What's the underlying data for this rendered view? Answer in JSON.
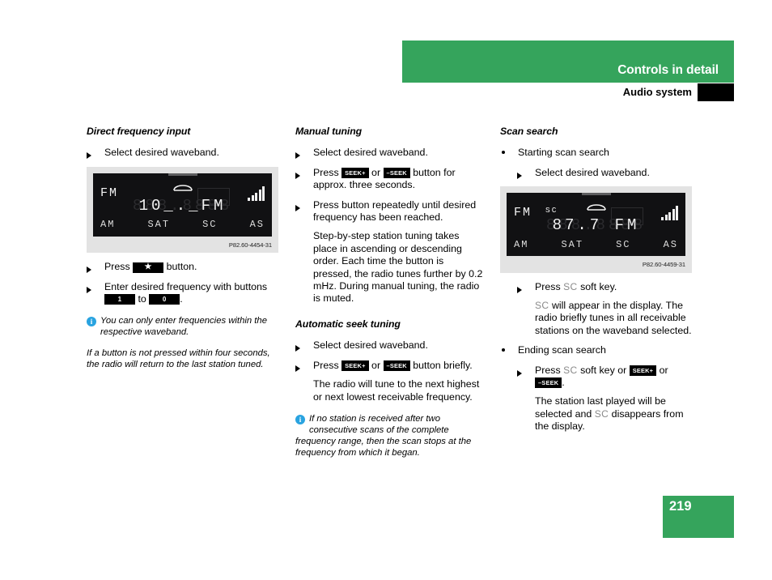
{
  "header": {
    "chapter_title": "Controls in detail",
    "section_title": "Audio system",
    "green": "#35a45c"
  },
  "footer": {
    "page_number": "219"
  },
  "columns": {
    "col1": {
      "heading": "Direct frequency input",
      "step1": "Select desired waveband.",
      "press_prefix": "Press",
      "star_key": "★",
      "press_suffix": "button.",
      "step3_text": "Enter desired frequency with buttons",
      "key_one": "1",
      "to_label": "to",
      "key_zero": "0",
      "period": ".",
      "note1": "You can only enter frequencies within the respective waveband.",
      "note2": "If a button is not pressed within four seconds, the radio will return to the last station tuned.",
      "figure": {
        "band": "FM",
        "frequency": "10_._FM",
        "ghost": "888.8888",
        "soft_keys": [
          "AM",
          "SAT",
          "SC",
          "AS"
        ],
        "caption": "P82.60-4454-31"
      }
    },
    "col2": {
      "heading1": "Manual tuning",
      "step1": "Select desired waveband.",
      "step2_pre": "Press",
      "key_seek_plus": "SEEK+",
      "or_label": "or",
      "key_seek_minus": "–SEEK",
      "step2_post": "button for approx. three seconds.",
      "step3": "Press button repeatedly until desired frequency has been reached.",
      "para1": "Step-by-step station tuning takes place in ascending or descending order. Each time the button is pressed, the radio tunes further by 0.2 mHz. During manual tuning, the radio is muted.",
      "heading2": "Automatic seek tuning",
      "step4": "Select desired waveband.",
      "step5_pre": "Press",
      "step5_post": "button briefly.",
      "para2": "The radio will tune to the next highest or next lowest receivable frequency.",
      "note1": "If no station is received after two consecutive scans of the complete frequency range, then the scan stops at the frequency from which it began."
    },
    "col3": {
      "heading": "Scan search",
      "bullet1": "Starting scan search",
      "sub1": "Select desired waveband.",
      "sub2_pre": "Press",
      "softkey_sc": "SC",
      "sub2_post": "soft key.",
      "para1_pre": "SC",
      "para1_post": "will appear in the display. The radio briefly tunes in all receivable stations on the waveband selected.",
      "bullet2": "Ending scan search",
      "sub3_pre": "Press",
      "sub3_mid": "soft key or",
      "key_seek_plus": "SEEK+",
      "or_label": "or",
      "key_seek_minus": "–SEEK",
      "sub3_end": ".",
      "para2_pre": "The station last played will be selected and",
      "para2_post": "disappears from the display.",
      "figure": {
        "band": "FM",
        "sc_indicator": "SC",
        "frequency": "87.7  FM",
        "ghost": "888.8888",
        "soft_keys": [
          "AM",
          "SAT",
          "SC",
          "AS"
        ],
        "caption": "P82.60-4459-31"
      }
    }
  }
}
